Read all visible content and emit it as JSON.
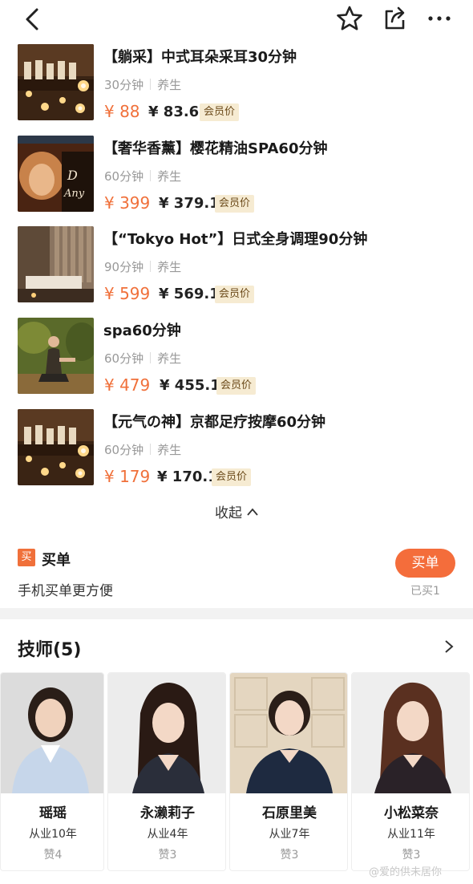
{
  "services": [
    {
      "title": "【躺采】中式耳朵采耳30分钟",
      "duration": "30分钟",
      "category": "养生",
      "price": "¥ 88",
      "member_price": "¥ 83.6",
      "badge": "会员价",
      "icon": "candles-photo"
    },
    {
      "title": "【奢华香薰】樱花精油SPA60分钟",
      "duration": "60分钟",
      "category": "养生",
      "price": "¥ 399",
      "member_price": "¥ 379.1",
      "badge": "会员价",
      "icon": "spa-poster-photo"
    },
    {
      "title": "【“Tokyo Hot”】日式全身调理90分钟",
      "duration": "90分钟",
      "category": "养生",
      "price": "¥ 599",
      "member_price": "¥ 569.1",
      "badge": "会员价",
      "icon": "treatment-room-photo"
    },
    {
      "title": "spa60分钟",
      "duration": "60分钟",
      "category": "养生",
      "price": "¥ 479",
      "member_price": "¥ 455.1",
      "badge": "会员价",
      "icon": "yoga-photo"
    },
    {
      "title": "【元气の神】京都足疗按摩60分钟",
      "duration": "60分钟",
      "category": "养生",
      "price": "¥ 179",
      "member_price": "¥ 170.1",
      "badge": "会员价",
      "icon": "candles-photo"
    }
  ],
  "collapse_label": "收起",
  "buy": {
    "tag": "买",
    "label": "买单",
    "description": "手机买单更方便",
    "button": "买单",
    "sold": "已买1"
  },
  "technicians": {
    "header": "技师(5)",
    "items": [
      {
        "name": "瑶瑶",
        "years": "从业10年",
        "likes": "赞4"
      },
      {
        "name": "永濑莉子",
        "years": "从业4年",
        "likes": "赞3"
      },
      {
        "name": "石原里美",
        "years": "从业7年",
        "likes": "赞3"
      },
      {
        "name": "小松菜奈",
        "years": "从业11年",
        "likes": "赞3"
      }
    ]
  },
  "watermark": "@爱的供未居你",
  "colors": {
    "accent": "#f0703a",
    "badge_bg": "#f6ebd2",
    "divider": "#f2f2f2"
  }
}
